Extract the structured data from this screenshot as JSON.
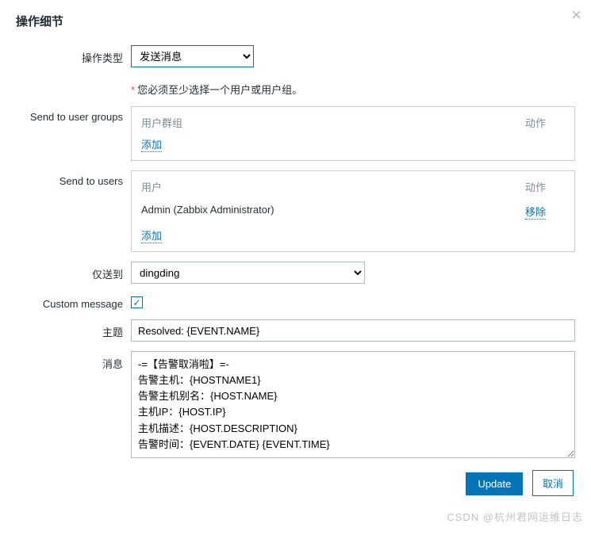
{
  "modal": {
    "title": "操作细节",
    "close_icon": "×"
  },
  "operation_type": {
    "label": "操作类型",
    "value": "发送消息"
  },
  "validation": {
    "asterisk": "*",
    "message": "您必须至少选择一个用户或用户组。"
  },
  "user_groups": {
    "label": "Send to user groups",
    "col_name": "用户群组",
    "col_action": "动作",
    "add": "添加"
  },
  "users": {
    "label": "Send to users",
    "col_name": "用户",
    "col_action": "动作",
    "rows": [
      {
        "name": "Admin (Zabbix Administrator)",
        "action": "移除"
      }
    ],
    "add": "添加"
  },
  "send_only_to": {
    "label": "仅送到",
    "value": "dingding"
  },
  "custom_message": {
    "label": "Custom message",
    "checked": "✓"
  },
  "subject": {
    "label": "主题",
    "value": "Resolved: {EVENT.NAME}"
  },
  "message": {
    "label": "消息",
    "value": "-=【告警取消啦】=-\n告警主机：{HOSTNAME1}\n告警主机别名：{HOST.NAME}\n主机IP：{HOST.IP}\n主机描述：{HOST.DESCRIPTION}\n告警时间：{EVENT.DATE} {EVENT.TIME}"
  },
  "buttons": {
    "update": "Update",
    "cancel": "取消"
  },
  "watermark": "CSDN @杭州君网运维日志"
}
